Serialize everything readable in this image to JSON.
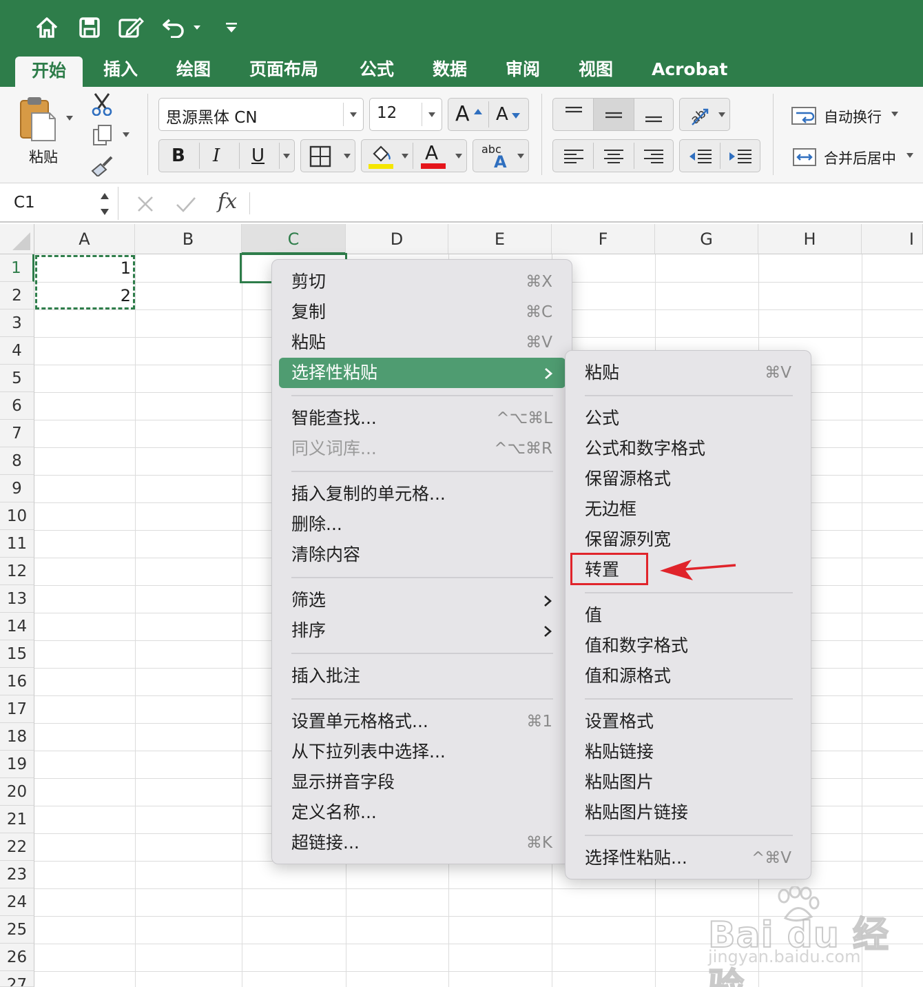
{
  "tabs": [
    "开始",
    "插入",
    "绘图",
    "页面布局",
    "公式",
    "数据",
    "审阅",
    "视图",
    "Acrobat"
  ],
  "ribbon": {
    "paste_label": "粘贴",
    "font_name": "思源黑体 CN",
    "font_size": "12",
    "grow_font": "A",
    "shrink_font": "A",
    "bold": "B",
    "italic": "I",
    "underline": "U",
    "font_color_letter": "A",
    "highlight_color": "#f5e600",
    "font_color": "#e5151b",
    "phonetic_top": "abc",
    "phonetic_bottom": "A",
    "wrap_text": "自动换行",
    "merge_center": "合并后居中"
  },
  "formula_bar": {
    "name_box": "C1",
    "fx": "fx"
  },
  "columns": [
    "A",
    "B",
    "C",
    "D",
    "E",
    "F",
    "G",
    "H",
    "I"
  ],
  "rows": [
    "1",
    "2",
    "3",
    "4",
    "5",
    "6",
    "7",
    "8",
    "9",
    "10",
    "11",
    "12",
    "13",
    "14",
    "15",
    "16",
    "17",
    "18",
    "19",
    "20",
    "21",
    "22",
    "23",
    "24",
    "25",
    "26",
    "27"
  ],
  "cells": {
    "A1": "1",
    "A2": "2"
  },
  "context_menu": {
    "items": [
      {
        "label": "剪切",
        "shortcut": "⌘X"
      },
      {
        "label": "复制",
        "shortcut": "⌘C"
      },
      {
        "label": "粘贴",
        "shortcut": "⌘V"
      },
      {
        "label": "选择性粘贴",
        "shortcut": ""
      },
      {
        "label": "智能查找...",
        "shortcut": "^⌥⌘L"
      },
      {
        "label": "同义词库...",
        "shortcut": "^⌥⌘R"
      },
      {
        "label": "插入复制的单元格...",
        "shortcut": ""
      },
      {
        "label": "删除...",
        "shortcut": ""
      },
      {
        "label": "清除内容",
        "shortcut": ""
      },
      {
        "label": "筛选",
        "shortcut": ""
      },
      {
        "label": "排序",
        "shortcut": ""
      },
      {
        "label": "插入批注",
        "shortcut": ""
      },
      {
        "label": "设置单元格格式...",
        "shortcut": "⌘1"
      },
      {
        "label": "从下拉列表中选择...",
        "shortcut": ""
      },
      {
        "label": "显示拼音字段",
        "shortcut": ""
      },
      {
        "label": "定义名称...",
        "shortcut": ""
      },
      {
        "label": "超链接...",
        "shortcut": "⌘K"
      }
    ]
  },
  "submenu": {
    "items": [
      {
        "label": "粘贴",
        "shortcut": "⌘V"
      },
      {
        "label": "公式",
        "shortcut": ""
      },
      {
        "label": "公式和数字格式",
        "shortcut": ""
      },
      {
        "label": "保留源格式",
        "shortcut": ""
      },
      {
        "label": "无边框",
        "shortcut": ""
      },
      {
        "label": "保留源列宽",
        "shortcut": ""
      },
      {
        "label": "转置",
        "shortcut": ""
      },
      {
        "label": "值",
        "shortcut": ""
      },
      {
        "label": "值和数字格式",
        "shortcut": ""
      },
      {
        "label": "值和源格式",
        "shortcut": ""
      },
      {
        "label": "设置格式",
        "shortcut": ""
      },
      {
        "label": "粘贴链接",
        "shortcut": ""
      },
      {
        "label": "粘贴图片",
        "shortcut": ""
      },
      {
        "label": "粘贴图片链接",
        "shortcut": ""
      },
      {
        "label": "选择性粘贴...",
        "shortcut": "^⌘V"
      }
    ]
  },
  "watermark": {
    "brand": "Bai du 经验",
    "url": "jingyan.baidu.com"
  },
  "colors": {
    "excel_green": "#2e7d4a",
    "menu_highlight": "#4f9c71",
    "annotation_red": "#e0242b"
  }
}
